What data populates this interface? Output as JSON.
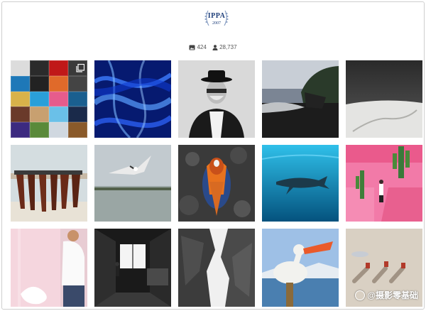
{
  "header": {
    "logo_text": "IPPA",
    "logo_year": "2007"
  },
  "stats": {
    "photos_count": "424",
    "followers_count": "28,737"
  },
  "grid": {
    "photos": [
      {
        "name": "photo-collage",
        "colors": [
          "#3a3a3a",
          "#c24",
          "#2a8fc9",
          "#e0a030"
        ]
      },
      {
        "name": "photo-blue-fabric",
        "colors": [
          "#0a2a8a",
          "#1e5cf0"
        ]
      },
      {
        "name": "photo-man-hat-portrait",
        "colors": [
          "#222",
          "#ddd"
        ]
      },
      {
        "name": "photo-coastal-rocks",
        "colors": [
          "#223",
          "#aab"
        ]
      },
      {
        "name": "photo-snow-desert",
        "colors": [
          "#222",
          "#eee"
        ]
      },
      {
        "name": "photo-legs-on-wall",
        "colors": [
          "#6a2a1a",
          "#cbd5d8"
        ]
      },
      {
        "name": "photo-seagull-lake",
        "colors": [
          "#aab6c0",
          "#eee"
        ]
      },
      {
        "name": "photo-mandarin-duck",
        "colors": [
          "#333",
          "#e05a20"
        ]
      },
      {
        "name": "photo-whale-underwater",
        "colors": [
          "#0a6fa0",
          "#2cc0e8"
        ]
      },
      {
        "name": "photo-pink-building",
        "colors": [
          "#f06aa0",
          "#3a8c3a"
        ]
      },
      {
        "name": "photo-pink-interior",
        "colors": [
          "#f3cfd8",
          "#fff"
        ]
      },
      {
        "name": "photo-dark-room-window",
        "colors": [
          "#222",
          "#ddd"
        ]
      },
      {
        "name": "photo-canyon-rocks",
        "colors": [
          "#333",
          "#999"
        ]
      },
      {
        "name": "photo-pelican",
        "colors": [
          "#8ab0d8",
          "#e8542a"
        ]
      },
      {
        "name": "photo-sand-shadows",
        "colors": [
          "#d8cfc2",
          "#a09080"
        ]
      }
    ]
  },
  "watermark": {
    "text": "@摄影零基础"
  }
}
